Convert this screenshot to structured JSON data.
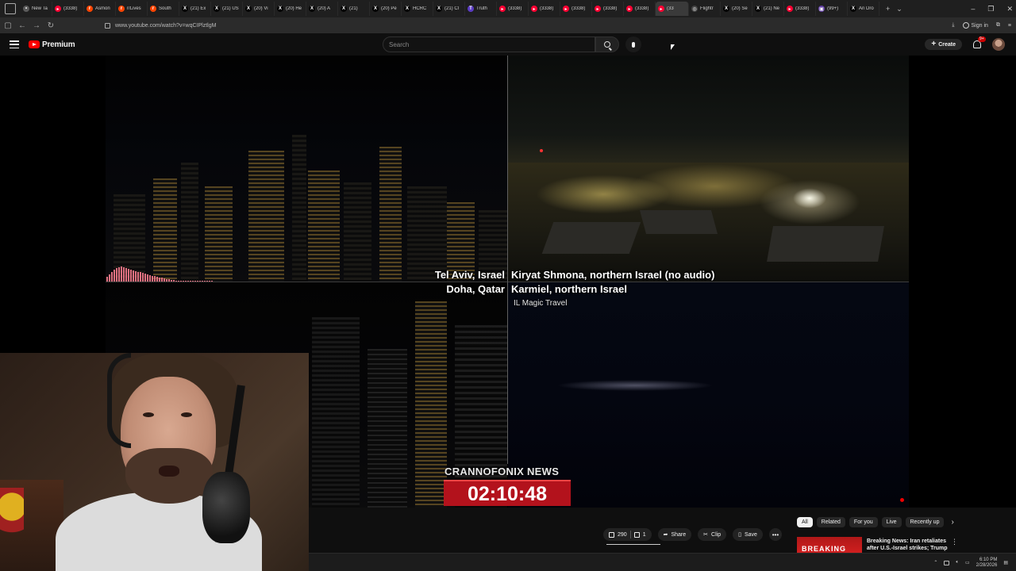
{
  "browser": {
    "tabs": [
      {
        "label": "New Ta",
        "fav_color": "#5a5a5a",
        "fav_glyph": "•"
      },
      {
        "label": "(3338)",
        "fav_color": "#ff0033",
        "fav_glyph": "▸"
      },
      {
        "label": "Asmon",
        "fav_color": "#ff4500",
        "fav_glyph": "r"
      },
      {
        "label": "r/Lives",
        "fav_color": "#ff4500",
        "fav_glyph": "r"
      },
      {
        "label": "South",
        "fav_color": "#ff4500",
        "fav_glyph": "r"
      },
      {
        "label": "(21) Ex",
        "fav_color": "#000000",
        "fav_glyph": "X"
      },
      {
        "label": "(21) US",
        "fav_color": "#000000",
        "fav_glyph": "X"
      },
      {
        "label": "(20) Vi",
        "fav_color": "#000000",
        "fav_glyph": "X"
      },
      {
        "label": "(20) He",
        "fav_color": "#000000",
        "fav_glyph": "X"
      },
      {
        "label": "(20) A",
        "fav_color": "#000000",
        "fav_glyph": "X"
      },
      {
        "label": "(21)",
        "fav_color": "#000000",
        "fav_glyph": "X"
      },
      {
        "label": "(20) Pe",
        "fav_color": "#000000",
        "fav_glyph": "X"
      },
      {
        "label": "HCRC",
        "fav_color": "#000000",
        "fav_glyph": "X"
      },
      {
        "label": "(21) Cl",
        "fav_color": "#000000",
        "fav_glyph": "X"
      },
      {
        "label": "Truth",
        "fav_color": "#5b3cc4",
        "fav_glyph": "T"
      },
      {
        "label": "(3338)",
        "fav_color": "#ff0033",
        "fav_glyph": "▸"
      },
      {
        "label": "(3338)",
        "fav_color": "#ff0033",
        "fav_glyph": "▸"
      },
      {
        "label": "(3338)",
        "fav_color": "#ff0033",
        "fav_glyph": "▸"
      },
      {
        "label": "(3338)",
        "fav_color": "#ff0033",
        "fav_glyph": "▸"
      },
      {
        "label": "(3338)",
        "fav_color": "#ff0033",
        "fav_glyph": "▸"
      },
      {
        "label": "(33",
        "fav_color": "#ff0033",
        "fav_glyph": "▸",
        "active": true
      },
      {
        "label": "Flightr",
        "fav_color": "#444444",
        "fav_glyph": "◎"
      },
      {
        "label": "(20) Se",
        "fav_color": "#000000",
        "fav_glyph": "X"
      },
      {
        "label": "(21) Ne",
        "fav_color": "#000000",
        "fav_glyph": "X"
      },
      {
        "label": "(3338)",
        "fav_color": "#ff0033",
        "fav_glyph": "▸"
      },
      {
        "label": "(99+)",
        "fav_color": "#6441a5",
        "fav_glyph": "▣"
      },
      {
        "label": "An Dro",
        "fav_color": "#000000",
        "fav_glyph": "X"
      }
    ],
    "new_tab": "+",
    "tab_list": "⌄",
    "url": "www.youtube.com/watch?v=wqCIPlztlgM",
    "sign_in": "Sign in",
    "minimize": "–",
    "maximize": "❐",
    "close": "✕"
  },
  "header": {
    "logo_text": "Premium",
    "search_placeholder": "Search",
    "create_label": "Create",
    "notif_badge": "9+"
  },
  "video": {
    "label_top_left_1": "Tel Aviv, Israel",
    "label_top_left_2": "Doha, Qatar",
    "label_top_right_1": "Kiryat Shmona, northern Israel (no audio)",
    "label_top_right_2": "Karmiel, northern Israel",
    "source_label": "IL Magic Travel",
    "news_brand": "CRANNOFONIX NEWS",
    "news_clock": "02:10:48"
  },
  "actions": {
    "likes": "290",
    "dislikes": "1",
    "share": "Share",
    "clip": "Clip",
    "save": "Save",
    "more": "•••"
  },
  "chips": [
    "All",
    "Related",
    "For you",
    "Live",
    "Recently up"
  ],
  "recommendation": {
    "thumb_text": "BREAKING",
    "title_line1": "Breaking News: Iran retaliates",
    "title_line2": "after U.S.-Israel strikes; Trump..."
  },
  "taskbar": {
    "time": "6:10 PM",
    "date": "2/28/2026"
  },
  "colors": {
    "yt_red": "#ff0000",
    "clock_bg": "#b3121c",
    "background": "#0f0f0f"
  }
}
